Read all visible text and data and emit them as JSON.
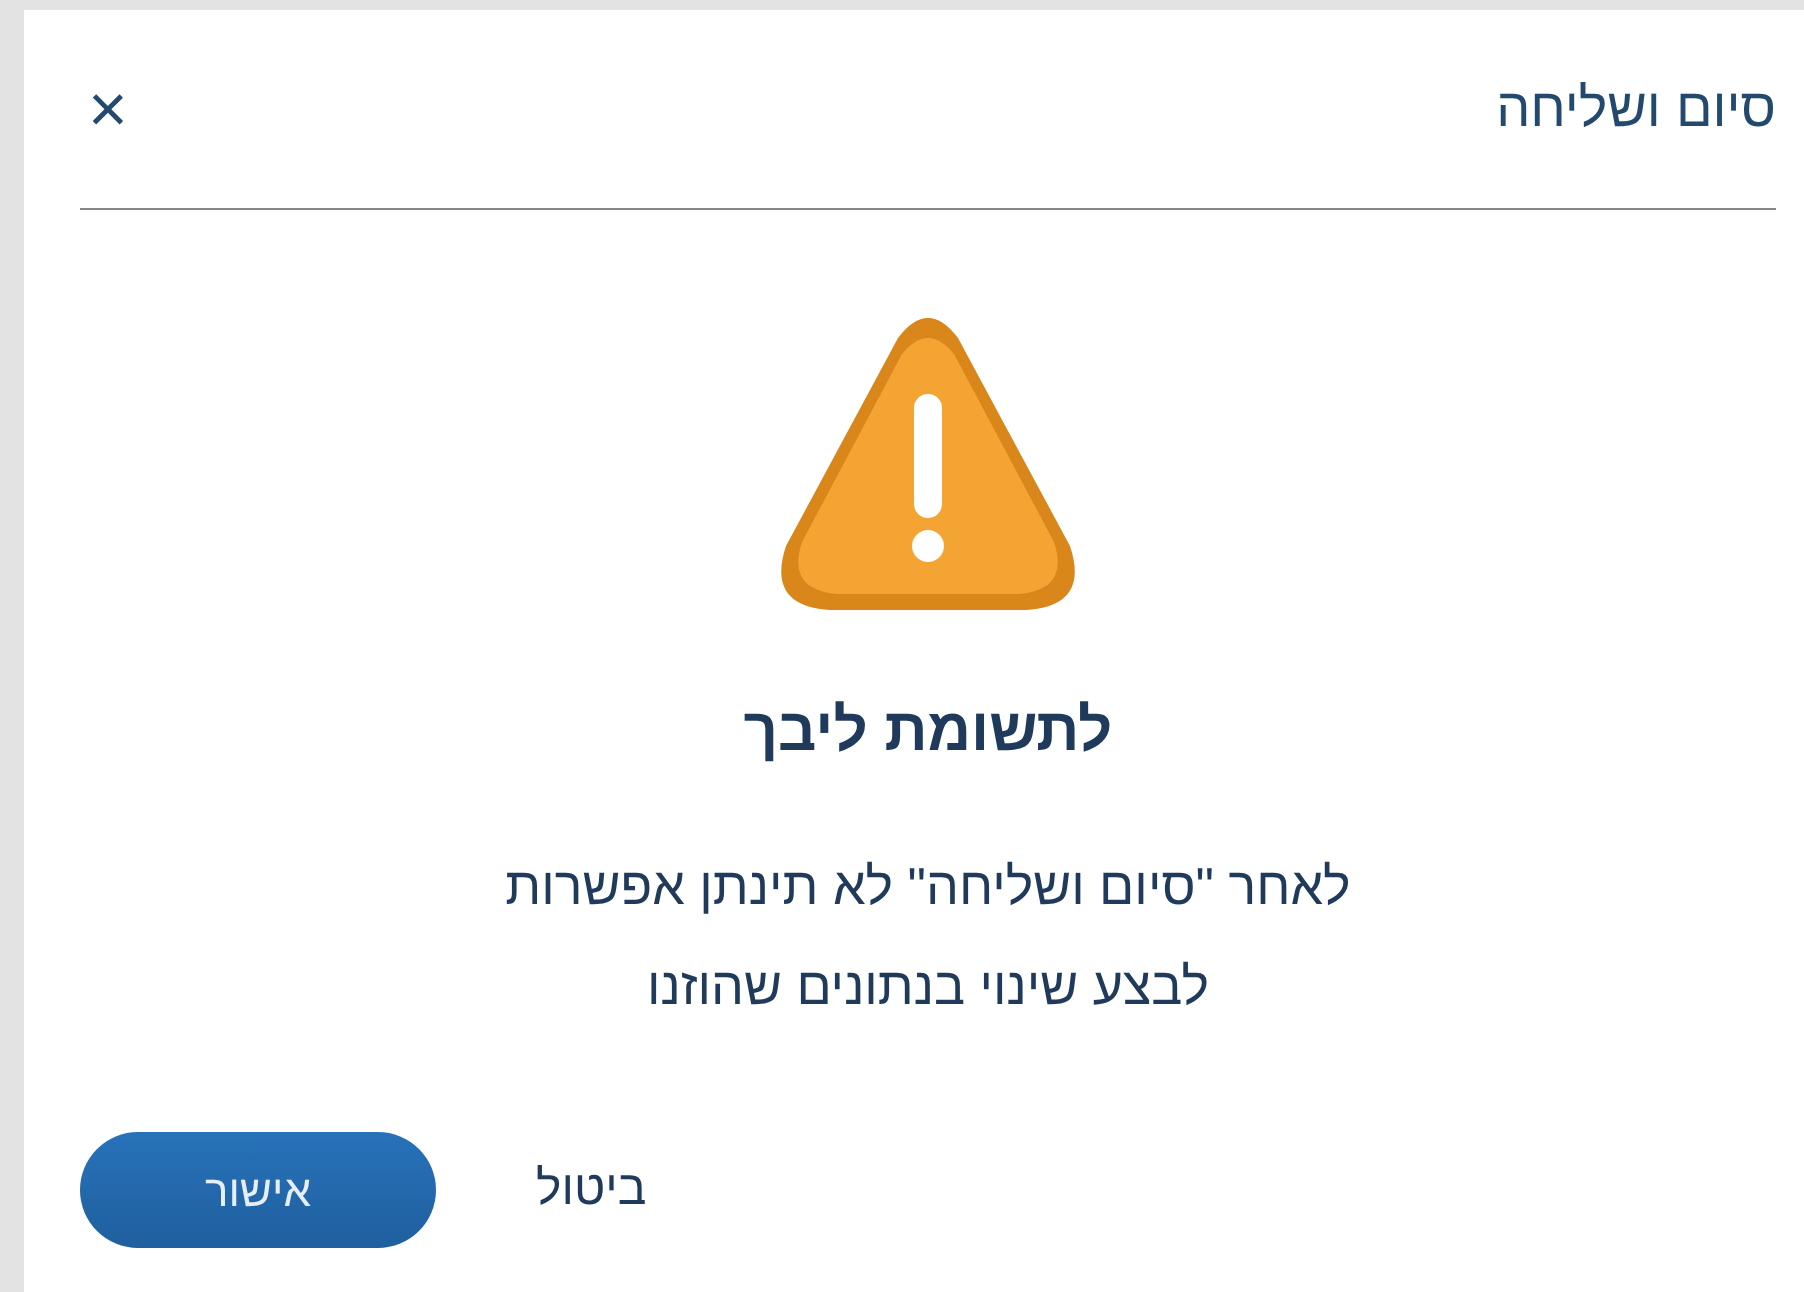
{
  "dialog": {
    "title": "סיום ושליחה",
    "close_icon": "×"
  },
  "warning": {
    "heading": "לתשומת ליבך",
    "message_lines": [
      "לאחר \"סיום ושליחה\" לא תינתן אפשרות",
      "לבצע שינוי בנתונים שהוזנו"
    ]
  },
  "buttons": [
    {
      "label": "ביטול",
      "kind": "text"
    },
    {
      "label": "אישור",
      "kind": "primary"
    }
  ]
}
